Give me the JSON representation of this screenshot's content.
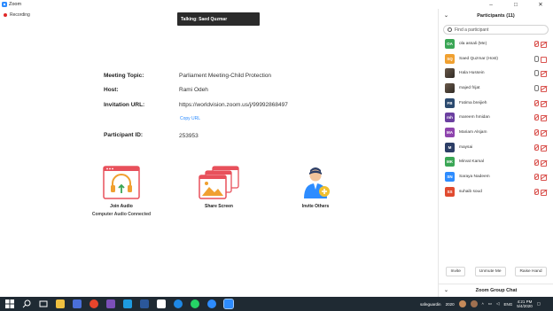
{
  "window": {
    "title": "Zoom",
    "controls": [
      "–",
      "□",
      "✕"
    ]
  },
  "recording": {
    "label": "Recording"
  },
  "talking": {
    "label": "Talking: Saed Quzmar"
  },
  "meeting": {
    "topic_label": "Meeting Topic:",
    "topic_value": "Parliament Meeting-Child Protection",
    "host_label": "Host:",
    "host_value": "Rami Odeh",
    "url_label": "Invitation URL:",
    "url_value": "https://worldvision.zoom.us/j/99992868497",
    "copy_url": "Copy URL",
    "pid_label": "Participant ID:",
    "pid_value": "253953"
  },
  "actions": {
    "join_audio": "Join Audio",
    "audio_status": "Computer Audio Connected",
    "share_screen": "Share Screen",
    "invite_others": "Invite Others"
  },
  "participants": {
    "title": "Participants (11)",
    "search_placeholder": "Find a participant",
    "list": [
      {
        "initials": "OA",
        "name": "ola assali (Me)",
        "color": "#3aa655",
        "photo": false,
        "mic": "muted",
        "cam": "off"
      },
      {
        "initials": "SQ",
        "name": "Saed Quzmar (Host)",
        "color": "#f0a030",
        "photo": false,
        "mic": "on",
        "cam": "on"
      },
      {
        "initials": "",
        "name": "Hala Hussein",
        "color": "#5a4a3a",
        "photo": true,
        "mic": "on",
        "cam": "off"
      },
      {
        "initials": "",
        "name": "majed frijat",
        "color": "#5a4a3a",
        "photo": true,
        "mic": "on",
        "cam": "off"
      },
      {
        "initials": "FB",
        "name": "Fatima breijieh",
        "color": "#2b4a6f",
        "photo": false,
        "mic": "muted",
        "cam": "off"
      },
      {
        "initials": "mh",
        "name": "mareem hmidan",
        "color": "#6b3fa0",
        "photo": false,
        "mic": "muted",
        "cam": "off"
      },
      {
        "initials": "MA",
        "name": "Mariam Alsjam",
        "color": "#8e44ad",
        "photo": false,
        "mic": "muted",
        "cam": "off"
      },
      {
        "initials": "M",
        "name": "maysai",
        "color": "#2c3e66",
        "photo": false,
        "mic": "muted",
        "cam": "off"
      },
      {
        "initials": "MK",
        "name": "Mirvat Kamal",
        "color": "#3aa655",
        "photo": false,
        "mic": "muted",
        "cam": "off"
      },
      {
        "initials": "SN",
        "name": "Saraya Nadeem",
        "color": "#2d8cff",
        "photo": false,
        "mic": "muted",
        "cam": "off"
      },
      {
        "initials": "SS",
        "name": "suhaib soud",
        "color": "#e04a2f",
        "photo": false,
        "mic": "muted",
        "cam": "off"
      }
    ],
    "footer": {
      "invite": "Invite",
      "unmute": "Unmute Me",
      "raise": "Raise Hand"
    }
  },
  "chat": {
    "title": "Zoom Group Chat"
  },
  "taskbar": {
    "user": "safeguardin",
    "year_label": "2020",
    "lang": "ENG",
    "time": "4:21 PM",
    "date": "5/4/2020"
  }
}
